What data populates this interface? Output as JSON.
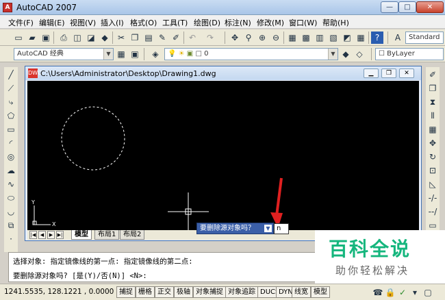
{
  "window": {
    "title": "AutoCAD 2007",
    "min": "—",
    "max": "□",
    "close": "✕"
  },
  "menu": [
    "文件(F)",
    "编辑(E)",
    "视图(V)",
    "插入(I)",
    "格式(O)",
    "工具(T)",
    "绘图(D)",
    "标注(N)",
    "修改(M)",
    "窗口(W)",
    "帮助(H)"
  ],
  "toolbar": {
    "text_style": "Standard",
    "workspace": "AutoCAD 经典",
    "layer": "0",
    "linetype": "ByLayer"
  },
  "drawing": {
    "title": "C:\\Users\\Administrator\\Desktop\\Drawing1.dwg",
    "ucs_y": "Y",
    "ucs_x": "X"
  },
  "tabs": [
    "模型",
    "布局1",
    "布局2"
  ],
  "popup": {
    "prompt": "要删除源对象吗？",
    "input": "n"
  },
  "command": {
    "line1": "选择对象:  指定镜像线的第一点: 指定镜像线的第二点:",
    "line2": "要删除源对象吗? [是(Y)/否(N)] <N>:"
  },
  "status": {
    "coords": "1241.5535, 128.1221 , 0.0000",
    "buttons": [
      "捕捉",
      "栅格",
      "正交",
      "极轴",
      "对象捕捉",
      "对象追踪",
      "DUCS",
      "DYN",
      "线宽",
      "模型"
    ]
  },
  "watermark": {
    "logo": "百科全说",
    "sub": "助你轻松解决"
  },
  "icons": [
    "line-icon",
    "circle-icon",
    "arc-icon",
    "polygon-icon",
    "rectangle-icon",
    "move-icon",
    "rotate-icon",
    "mirror-icon",
    "copy-icon",
    "erase-icon"
  ]
}
